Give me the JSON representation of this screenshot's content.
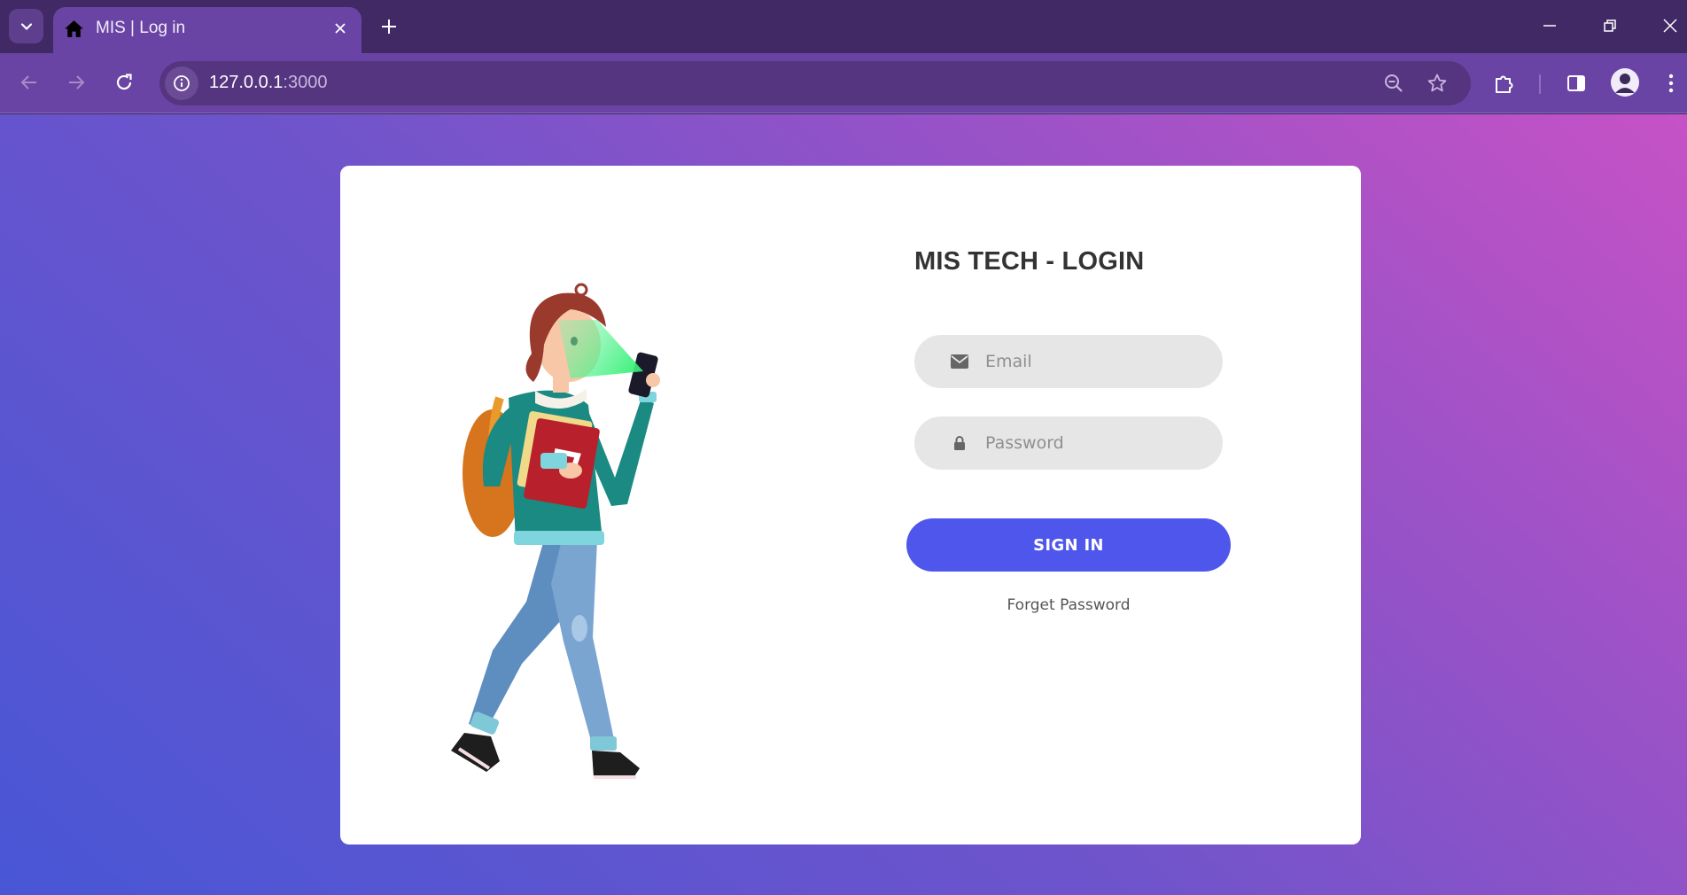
{
  "browser": {
    "tab_title": "MIS | Log in",
    "url_host": "127.0.0.1",
    "url_port": ":3000"
  },
  "login": {
    "title": "MIS TECH - LOGIN",
    "email_placeholder": "Email",
    "password_placeholder": "Password",
    "signin_label": "SIGN IN",
    "forget_label": "Forget Password"
  },
  "colors": {
    "chrome_dark": "#412965",
    "chrome_toolbar": "#6a44a4",
    "button": "#4e56ec",
    "field_bg": "#e6e6e6",
    "gradient_start": "#4856d6",
    "gradient_end": "#c652c6"
  }
}
